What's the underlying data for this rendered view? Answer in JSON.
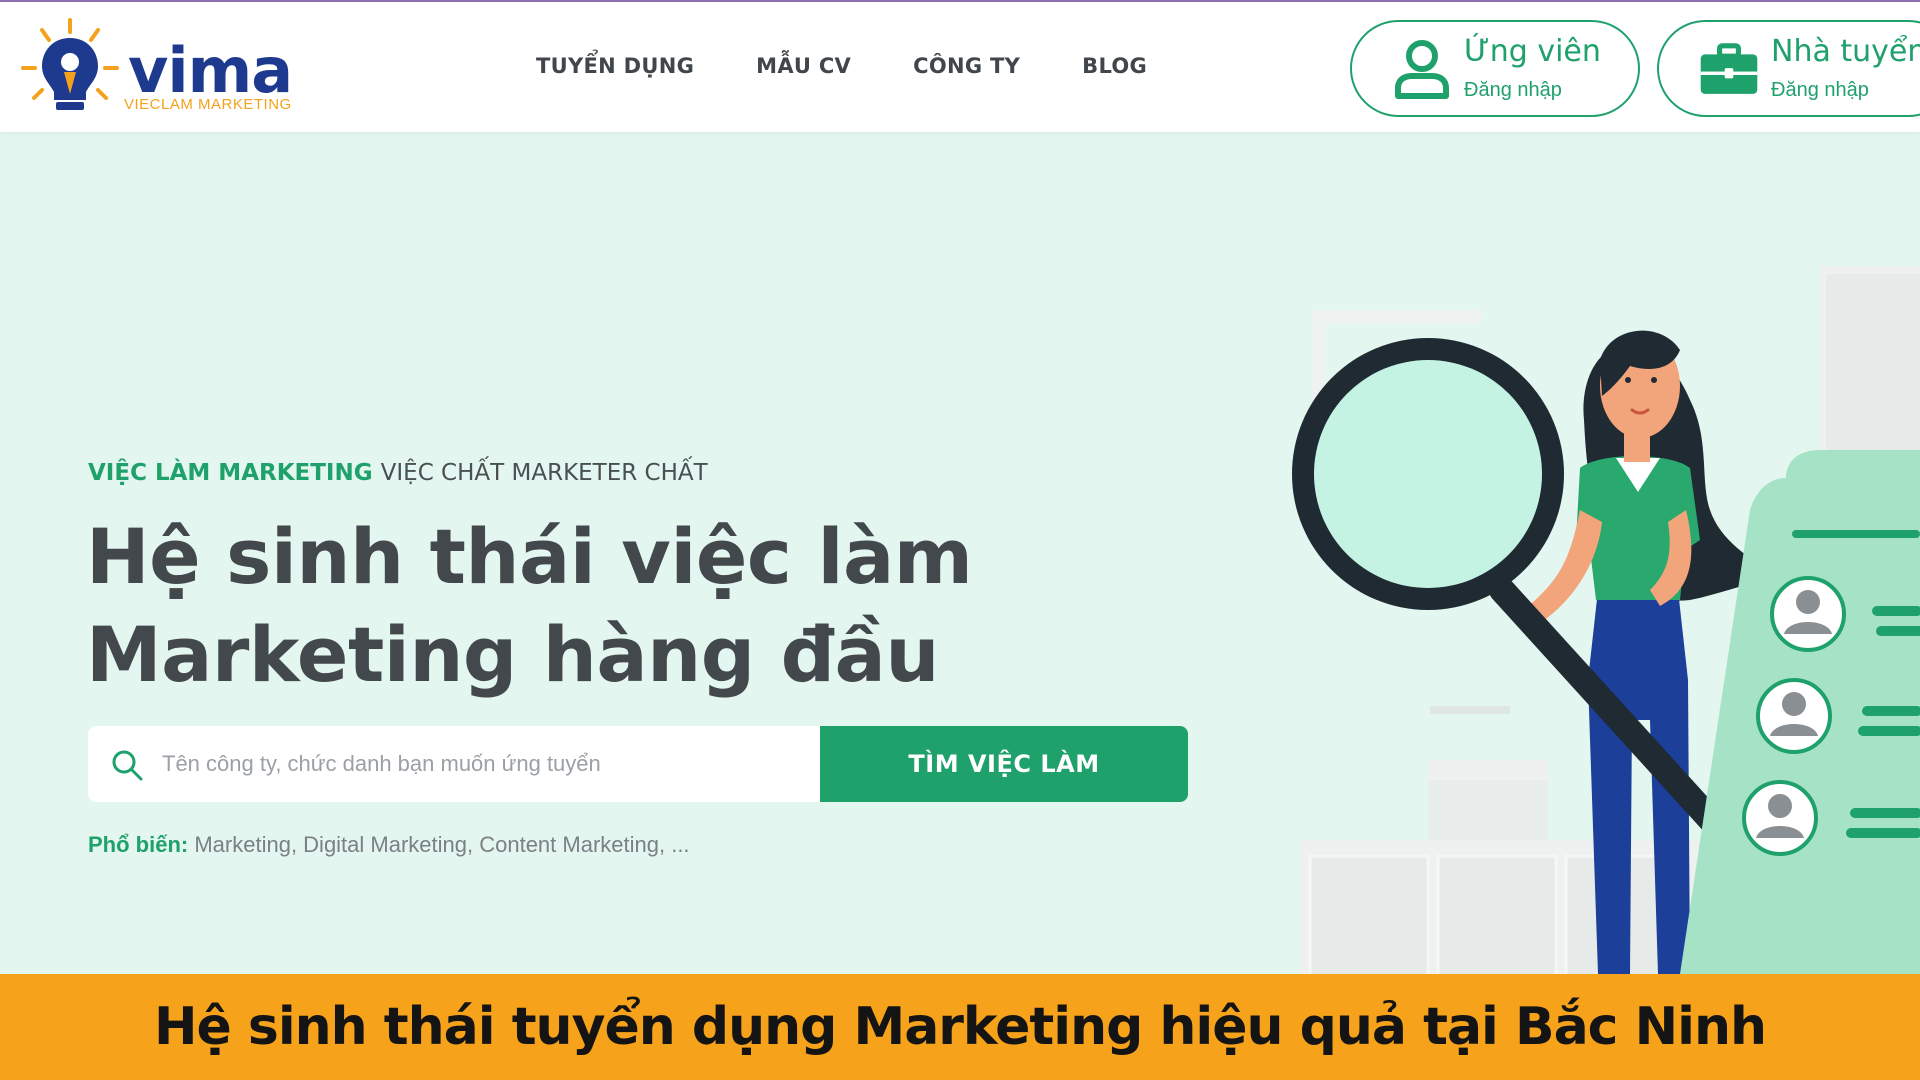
{
  "header": {
    "logo": {
      "word": "vima",
      "subtitle": "VIECLAM MARKETING"
    },
    "nav": [
      "TUYỂN DỤNG",
      "MẪU CV",
      "CÔNG TY",
      "BLOG"
    ],
    "candidate": {
      "title": "Ứng viên",
      "sub": "Đăng nhập"
    },
    "employer": {
      "title": "Nhà tuyển dụng",
      "sub": "Đăng nhập"
    }
  },
  "hero": {
    "tagline_highlight": "VIỆC LÀM MARKETING",
    "tagline_rest": "VIỆC CHẤT MARKETER CHẤT",
    "headline_line1": "Hệ sinh thái việc làm",
    "headline_line2": "Marketing hàng đầu",
    "search_placeholder": "Tên công ty, chức danh bạn muốn ứng tuyển",
    "search_button": "TÌM VIỆC LÀM",
    "popular_label": "Phổ biến:",
    "popular_values": "Marketing, Digital Marketing, Content Marketing, ..."
  },
  "banner": {
    "text": "Hệ sinh thái tuyển dụng Marketing hiệu quả tại Bắc Ninh"
  },
  "colors": {
    "brand_green": "#1fa16b",
    "logo_blue": "#1d3a8f",
    "logo_orange": "#f4a21c",
    "banner": "#f7a21b",
    "hero_bg": "#e3f6ef"
  }
}
